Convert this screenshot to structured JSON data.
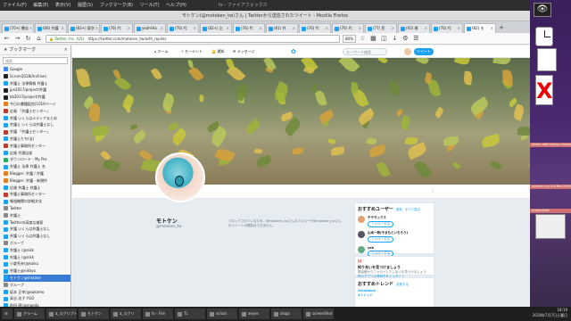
{
  "topbar": {
    "menus": [
      "ファイル(F)",
      "編集(E)",
      "表示(V)",
      "履歴(S)",
      "ブックマーク(B)",
      "ツール(T)",
      "ヘルプ(H)"
    ],
    "center": "fx - ファイアフォックス"
  },
  "window": {
    "title": "モトケン(@motoken_tw)さん | Twitterから送信されたツイート - Mozilla Firefox"
  },
  "tabs": [
    {
      "label": "(70+) 書店"
    },
    {
      "label": "(66) 弁護"
    },
    {
      "label": "(83+) 東京"
    },
    {
      "label": "(76) 代"
    },
    {
      "label": "yeah!Ha"
    },
    {
      "label": "(76) 代"
    },
    {
      "label": "(82+) 企"
    },
    {
      "label": "(76) 代"
    },
    {
      "label": "(81) 弁"
    },
    {
      "label": "(76) 代"
    },
    {
      "label": "(76) 代"
    },
    {
      "label": "(77) 民"
    },
    {
      "label": "(93) 規"
    },
    {
      "label": "(76) 代"
    },
    {
      "label": "(82) モ"
    }
  ],
  "navbar": {
    "url_org": "Twitter, Inc. (US)",
    "url": "https://twitter.com/motoken_tw/with_replies",
    "zoom": "80%"
  },
  "sidebar": {
    "title": "ブックマーク",
    "search_placeholder": "検索",
    "items": [
      {
        "label": "Google",
        "color": "#4285f4"
      },
      {
        "label": "Scrum2018(Archive)",
        "color": "#222"
      },
      {
        "label": "弁護士 法律情報 弁護士",
        "color": "#1da1f2"
      },
      {
        "label": "jpn2017/project/弁護",
        "color": "#222"
      },
      {
        "label": "kb2017/project/弁護",
        "color": "#222"
      },
      {
        "label": "今日の書籍配信(1016ページ",
        "color": "#e67e22"
      },
      {
        "label": "広報 「弁護士センター」",
        "color": "#c0392b"
      },
      {
        "label": "弁護 いくらはメディアまとめ",
        "color": "#1da1f2"
      },
      {
        "label": "弁護士 いくらは弁護士なし",
        "color": "#1da1f2"
      },
      {
        "label": "弁護 「弁護士センター」",
        "color": "#c0392b"
      },
      {
        "label": "弁護士たち(法)",
        "color": "#1da1f2"
      },
      {
        "label": "弁護士事務所センター",
        "color": "#c0392b"
      },
      {
        "label": "広報 代理店部",
        "color": "#1da1f2"
      },
      {
        "label": "ダウンロード - My Pro",
        "color": "#27ae60"
      },
      {
        "label": "弁護士 法律 弁護士 名",
        "color": "#1da1f2"
      },
      {
        "label": "Blogger: 弁護 / 弁護",
        "color": "#e67e22"
      },
      {
        "label": "Blogger: 弁護 - 新規作",
        "color": "#e67e22"
      },
      {
        "label": "広報 弁護士 弁護士",
        "color": "#1da1f2"
      },
      {
        "label": "弁護士事務所センター",
        "color": "#c0392b"
      },
      {
        "label": "報道機関の詳細文化",
        "color": "#1da1f2"
      },
      {
        "label": "Twitter",
        "color": "#888"
      },
      {
        "label": "弁護士",
        "color": "#888"
      },
      {
        "label": "Twitterの高度な検索",
        "color": "#1da1f2"
      },
      {
        "label": "弁護 いくらは弁護士なし",
        "color": "#1da1f2"
      },
      {
        "label": "弁護 いくらは弁護士なし",
        "color": "#1da1f2"
      },
      {
        "label": "グループ",
        "color": "#888"
      },
      {
        "label": "弁護士 (@nikk",
        "color": "#1da1f2"
      },
      {
        "label": "弁護士 (@nikk",
        "color": "#1da1f2"
      },
      {
        "label": "小倉秀夫(@koiku",
        "color": "#1da1f2"
      },
      {
        "label": "弁護士@nikkyo",
        "color": "#1da1f2"
      },
      {
        "label": "モトケン@motoke",
        "color": "#1da1f2"
      },
      {
        "label": "グループ",
        "color": "#888"
      },
      {
        "label": "坂本 正幸(@sakamo",
        "color": "#1da1f2"
      },
      {
        "label": "高谷 治子 YGO",
        "color": "#1da1f2"
      },
      {
        "label": "前田 原(@maeda",
        "color": "#1da1f2"
      },
      {
        "label": "弁護士の弁護 (@bengo",
        "color": "#1da1f2"
      },
      {
        "label": "弁護士中(@b",
        "color": "#1da1f2"
      },
      {
        "label": "弁護士 (@bego",
        "color": "#1da1f2"
      }
    ]
  },
  "twitter": {
    "nav": [
      "ホーム",
      "モーメント",
      "通知",
      "メッセージ"
    ],
    "search_placeholder": "キーワード検索",
    "tweet_button": "ツイート",
    "profile_name": "モトケン",
    "profile_handle": "@motoken_tw",
    "bio": "ブロックされているため、@motoken_twさんのフォローや@motoken_twさんのツイートの閲覧はできません。",
    "who_to_follow": {
      "title": "おすすめユーザー",
      "refresh": "更新",
      "all": "すべて見る",
      "users": [
        {
          "name": "テララックス",
          "handle": "@terra",
          "follow": "フォローする"
        },
        {
          "name": "山本一郎(やまもといちろう)",
          "handle": "@kirik",
          "follow": "フォローする"
        },
        {
          "name": "yek",
          "handle": "@yek",
          "follow": "フォローする"
        }
      ]
    },
    "find_friends": {
      "title": "知り合いを見つけましょう",
      "text": "電話帳からフォローしている人を見つけましょう",
      "link": "他のアプリの連絡先をインポート"
    },
    "trends": {
      "title": "おすすめトレンド",
      "change": "変更する",
      "items": [
        "#motoken",
        "#トレンド"
      ]
    }
  },
  "taskbar": {
    "items": [
      "アラーム",
      "a_スクリプト",
      "モトケン",
      "a_スクリ",
      "fx - Fire",
      "TL",
      "xclock",
      "xeyes",
      "xlogo",
      "screenShot"
    ],
    "clock_time": "18:19",
    "clock_date": "2018年7月7日土曜日"
  },
  "desktop": {
    "labels": [
      "xterm-add-mytop-chrome-f",
      "memory-yy-2018fb-2018f",
      "screenShot"
    ]
  }
}
